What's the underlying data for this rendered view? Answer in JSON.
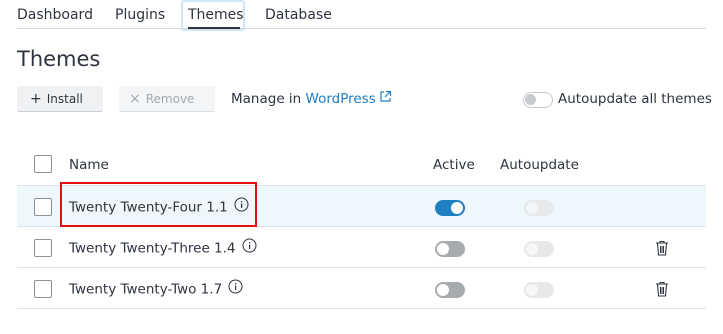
{
  "tabs": [
    {
      "label": "Dashboard"
    },
    {
      "label": "Plugins"
    },
    {
      "label": "Themes",
      "active": true
    },
    {
      "label": "Database"
    }
  ],
  "page": {
    "title": "Themes"
  },
  "toolbar": {
    "install_label": "Install",
    "remove_label": "Remove",
    "manage_prefix": "Manage in ",
    "manage_link": "WordPress",
    "autoupdate_all_label": "Autoupdate all themes",
    "autoupdate_all_on": false
  },
  "table": {
    "columns": {
      "name": "Name",
      "active": "Active",
      "autoupdate": "Autoupdate"
    },
    "rows": [
      {
        "name": "Twenty Twenty-Four 1.1",
        "active": true,
        "autoupdate": false,
        "deletable": false,
        "highlighted": true
      },
      {
        "name": "Twenty Twenty-Three 1.4",
        "active": false,
        "autoupdate": false,
        "deletable": true,
        "highlighted": false
      },
      {
        "name": "Twenty Twenty-Two 1.7",
        "active": false,
        "autoupdate": false,
        "deletable": true,
        "highlighted": false
      }
    ]
  },
  "colors": {
    "accent": "#1e7fc3",
    "highlight_border": "#e31010",
    "row_highlight": "#eef7fc"
  }
}
